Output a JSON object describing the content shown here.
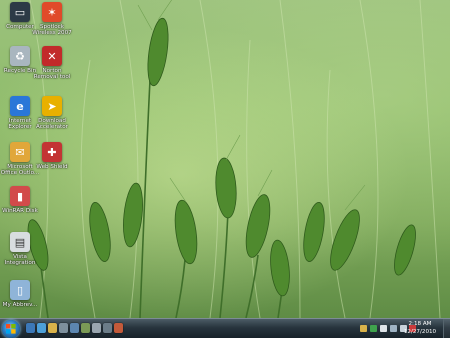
{
  "desktop": {
    "icons": [
      {
        "label": "Computer",
        "icon": "computer-icon",
        "color": "#2c3a46"
      },
      {
        "label": "Spotlock Wireless 2007",
        "icon": "spotlock-icon",
        "color": "#e04a2a"
      },
      {
        "label": "Recycle Bin",
        "icon": "recycle-bin-icon",
        "color": "#a9b6bf"
      },
      {
        "label": "Norton Removal tool",
        "icon": "norton-icon",
        "color": "#c22a2a"
      },
      {
        "label": "Internet Explorer",
        "icon": "internet-explorer-icon",
        "color": "#2a77d8"
      },
      {
        "label": "Download Accelerator",
        "icon": "download-accelerator-icon",
        "color": "#e8b000"
      },
      {
        "label": "Microsoft Office Outlo...",
        "icon": "outlook-icon",
        "color": "#e1a73a"
      },
      {
        "label": "Web Shield",
        "icon": "web-shield-icon",
        "color": "#c33434"
      },
      {
        "label": "WinRAR Disk",
        "icon": "winrar-icon",
        "color": "#d24b4b"
      },
      {
        "label": "Vista Integration",
        "icon": "vista-integration-icon",
        "color": "#d8dde0"
      },
      {
        "label": "My Abbrev...",
        "icon": "document-icon",
        "color": "#8fb4d8"
      }
    ]
  },
  "taskbar": {
    "start_icon": "windows-logo-icon",
    "apps": [
      {
        "name": "explorer-taskbar-icon",
        "color": "#3c78b7"
      },
      {
        "name": "media-player-taskbar-icon",
        "color": "#4da0d8"
      },
      {
        "name": "folder-taskbar-icon",
        "color": "#d9b24a"
      },
      {
        "name": "app-taskbar-icon",
        "color": "#7d8f9c"
      },
      {
        "name": "mail-taskbar-icon",
        "color": "#5c86b0"
      },
      {
        "name": "network-taskbar-icon",
        "color": "#7b9a56"
      },
      {
        "name": "tool-taskbar-icon",
        "color": "#9aa6b0"
      },
      {
        "name": "app2-taskbar-icon",
        "color": "#6b7c88"
      },
      {
        "name": "app3-taskbar-icon",
        "color": "#c35a3a"
      }
    ],
    "tray": [
      {
        "name": "tray-folder-icon",
        "color": "#d9b24a"
      },
      {
        "name": "tray-green-icon",
        "color": "#3fa34d"
      },
      {
        "name": "tray-flag-icon",
        "color": "#dfe4e8"
      },
      {
        "name": "tray-network-icon",
        "color": "#9fb3c4"
      },
      {
        "name": "tray-volume-icon",
        "color": "#c7d2da"
      },
      {
        "name": "tray-red-icon",
        "color": "#cc3b3b"
      }
    ],
    "time": "2:18 AM",
    "date": "12/27/2010"
  }
}
